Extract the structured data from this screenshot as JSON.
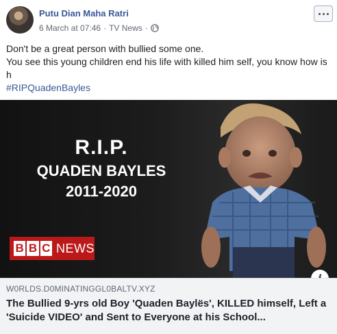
{
  "post": {
    "author": "Putu Dian Maha Ratri",
    "date": "6 March at 07:46",
    "separator": "·",
    "source": "TV News",
    "separator2": "·",
    "text_line1": "Don't be a great person with bullied some one.",
    "text_line2": "You see this young children end his life with killed him self, you know how is h",
    "hashtag": "#RIPQuadenBayles"
  },
  "image": {
    "rip": "R.I.P.",
    "name": "QUADEN BAYLES",
    "years": "2011-2020",
    "logo_b1": "B",
    "logo_b2": "B",
    "logo_c": "C",
    "logo_news": "NEWS"
  },
  "link": {
    "domain": "W0RLDS.D0MINATINGGL0BALTV.XYZ",
    "title": "The Bullied 9-yrs old Boy 'Quaden Baylës', KILLED himself, Left a 'Suicide VIDEO' and Sent to Everyone at his School..."
  },
  "icons": {
    "more": "more-options-icon",
    "privacy": "globe-icon",
    "info": "info-icon"
  },
  "colors": {
    "link_blue": "#385898",
    "bbc_red": "#bb1919",
    "link_box_bg": "#f2f3f5"
  }
}
